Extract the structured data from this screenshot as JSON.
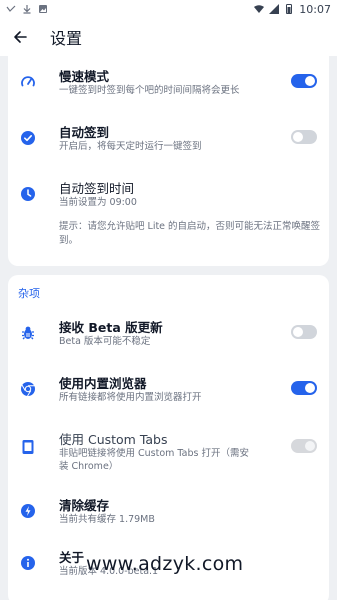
{
  "status_bar": {
    "time": "10:07"
  },
  "app_bar": {
    "title": "设置",
    "back_icon": "arrow-back-icon"
  },
  "colors": {
    "accent": "#2563eb",
    "toggle_off": "#d1d5db"
  },
  "card1": {
    "rows": [
      {
        "title": "慢速模式",
        "subtitle": "一键签到时签到每个吧的时间间隔将会更长",
        "icon": "speedometer-icon",
        "toggle": "on"
      },
      {
        "title": "自动签到",
        "subtitle": "开启后，将每天定时运行一键签到",
        "icon": "check-circle-icon",
        "toggle": "off"
      },
      {
        "title": "自动签到时间",
        "subtitle": "当前设置为 09:00",
        "icon": "clock-icon"
      }
    ],
    "hint": "提示：请您允许贴吧 Lite 的自启动，否则可能无法正常唤醒签到。"
  },
  "card2": {
    "section_title": "杂项",
    "rows": [
      {
        "title": "接收 Beta 版更新",
        "subtitle": "Beta 版本可能不稳定",
        "icon": "bug-icon",
        "toggle": "off"
      },
      {
        "title": "使用内置浏览器",
        "subtitle": "所有链接都将使用内置浏览器打开",
        "icon": "chrome-icon",
        "toggle": "on"
      },
      {
        "title": "使用 Custom Tabs",
        "subtitle": "非贴吧链接将使用 Custom Tabs 打开（需安装 Chrome）",
        "icon": "tablet-icon",
        "toggle": "disabled"
      },
      {
        "title": "清除缓存",
        "subtitle": "当前共有缓存 1.79MB",
        "icon": "flash-icon"
      },
      {
        "title": "关于",
        "subtitle": "当前版本 4.0.0-beta.1",
        "icon": "info-icon"
      }
    ]
  },
  "watermark": "www.adzyk.com"
}
